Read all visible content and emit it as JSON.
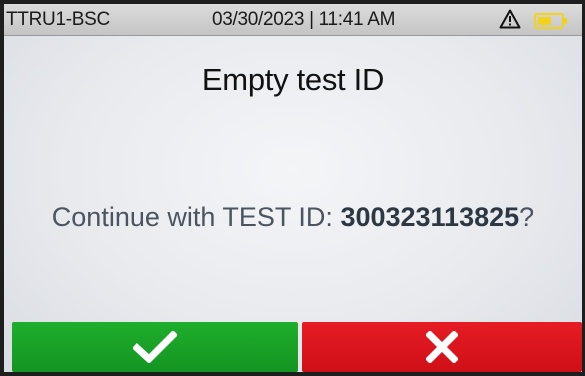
{
  "status_bar": {
    "device_id": "TTRU1-BSC",
    "datetime": "03/30/2023 | 11:41 AM",
    "warning_icon": "warning-triangle-icon",
    "battery_icon": "battery-low-icon",
    "battery_color": "#f2d21b"
  },
  "dialog": {
    "title": "Empty test ID",
    "prompt_prefix": "Continue with TEST ID: ",
    "test_id": "300323113825",
    "prompt_suffix": "?"
  },
  "buttons": {
    "confirm_icon": "checkmark-icon",
    "confirm_color": "#17a326",
    "cancel_icon": "x-close-icon",
    "cancel_color": "#dc141c"
  }
}
